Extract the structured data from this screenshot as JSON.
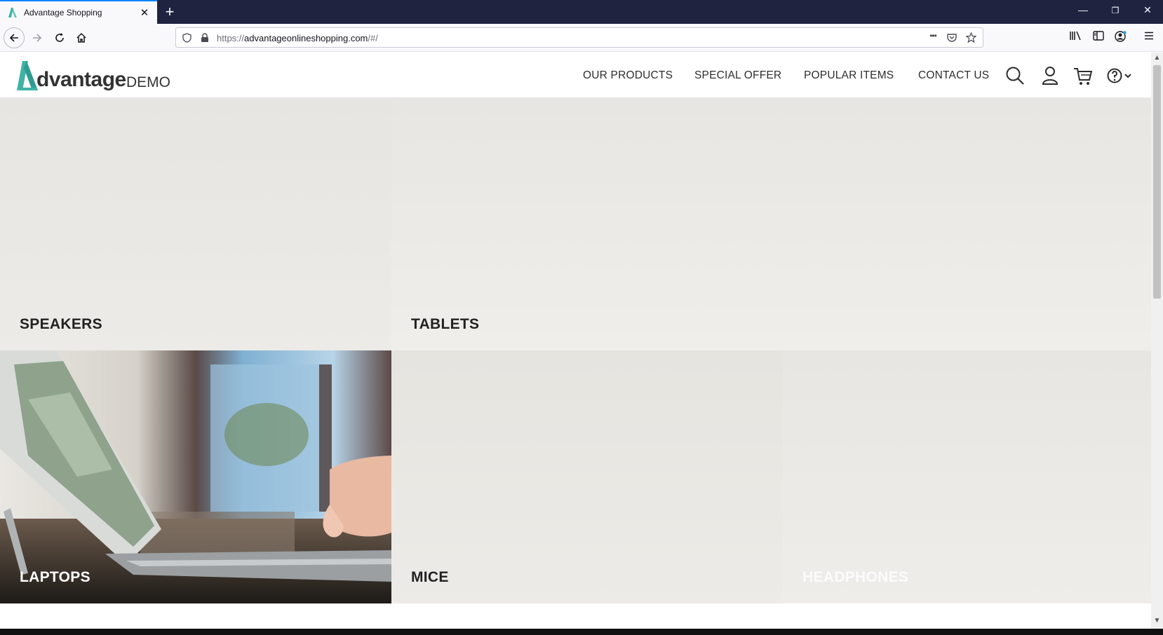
{
  "browser": {
    "tab_title": "Advantage Shopping",
    "tab_close": "✕",
    "new_tab": "+",
    "url_scheme": "https://",
    "url_host": "advantageonlineshopping.com",
    "url_path": "/#/",
    "page_actions": "•••",
    "window_controls": {
      "minimize": "—",
      "restore": "❐",
      "close": "✕"
    }
  },
  "site": {
    "logo_word": "dvantage",
    "logo_demo": "DEMO",
    "brand_color": "#3fb3a5",
    "menu": [
      {
        "label": "OUR PRODUCTS"
      },
      {
        "label": "SPECIAL OFFER"
      },
      {
        "label": "POPULAR ITEMS"
      },
      {
        "label": "CONTACT US"
      }
    ],
    "icons": [
      "search-icon",
      "user-icon",
      "cart-icon",
      "help-icon"
    ]
  },
  "categories": [
    {
      "label": "SPEAKERS"
    },
    {
      "label": "TABLETS"
    },
    {
      "label": "LAPTOPS"
    },
    {
      "label": "MICE"
    },
    {
      "label": "HEADPHONES"
    }
  ]
}
